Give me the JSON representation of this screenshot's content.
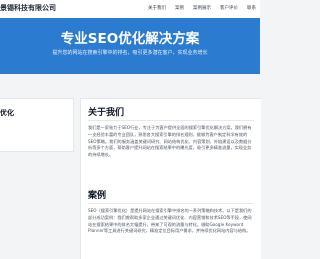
{
  "header": {
    "company": "景锡科技有限公司",
    "nav": [
      "关于我们",
      "案例",
      "案例展示",
      "客户评价",
      "联系"
    ]
  },
  "hero": {
    "title": "专业SEO优化解决方案",
    "subtitle": "提升您的网站在搜索引擎中的排名，吸引更多潜在客户，实现业务增长"
  },
  "sidebar": {
    "title": "优化"
  },
  "about": {
    "heading": "关于我们",
    "text": "我们是一家致力于SEO行业，专注于为客户提供全面的搜索引擎优化解决方案。我们拥有一支经验丰富的专业团队，熟悉各大搜索引擎的排名规则，能够为客户制定科学有效的SEO策略。我们的服务涵盖关键词研究、网站结构优化、内容策划、外链建设以及数据分析等多个方面，帮助客户提升网站在搜索结果中的曝光度，吸引更多精准流量，实现业务的持续增长。"
  },
  "cases": {
    "heading": "案例",
    "text": "SEO（搜索引擎优化）是提升网站在搜索引擎中排名的一系列策略和技术。以下是我们的部分成功案例：我们曾帮助多家企业通过关键词优化、内容营销和技术SEO等手段，使网站在搜索结果中的排名大幅提升，带来了可观的流量与转化。借助Google Keyword Planner等工具进行关键词研究，精准定位目标用户需求，并持续优化网站内容与结构。"
  }
}
